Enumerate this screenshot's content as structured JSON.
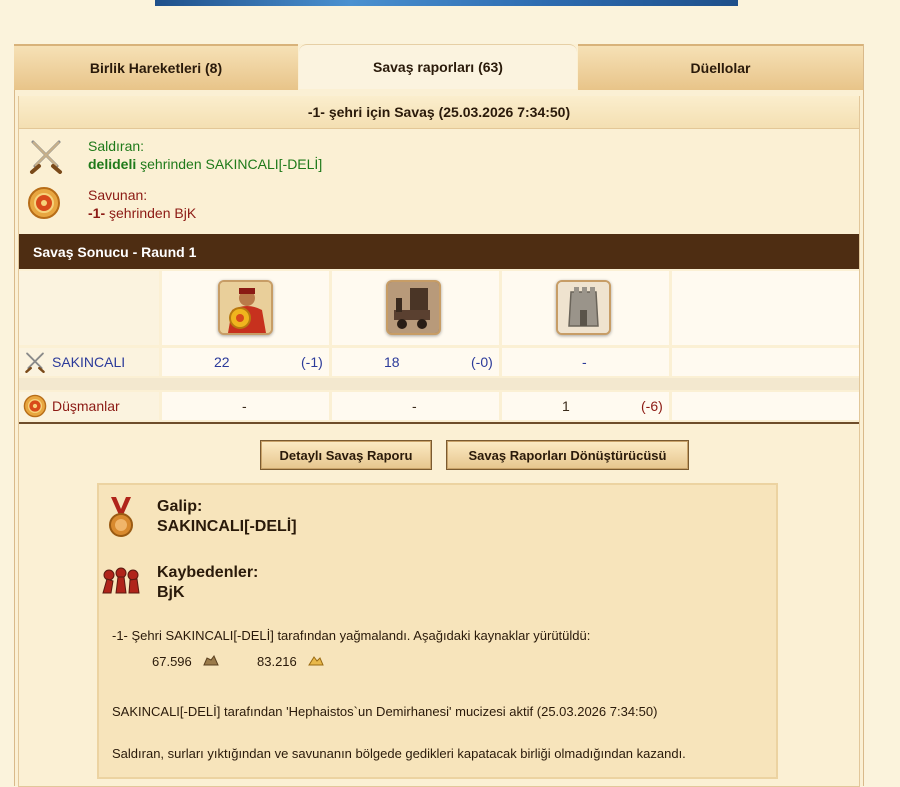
{
  "tabs": [
    {
      "label": "Birlik Hareketleri (8)"
    },
    {
      "label": "Savaş raporları (63)"
    },
    {
      "label": "Düellolar"
    }
  ],
  "report": {
    "title": "-1- şehri için Savaş (25.03.2026 7:34:50)",
    "attacker": {
      "role_label": "Saldıran:",
      "city": "delideli",
      "text": " şehrinden SAKINCALI[-DELİ]"
    },
    "defender": {
      "role_label": "Savunan:",
      "city": "-1-",
      "text": " şehrinden BjK"
    },
    "result_title": "Savaş Sonucu - Raund 1",
    "rows": [
      {
        "name": "SAKINCALI",
        "cells": [
          {
            "value": "22",
            "loss": "(-1)"
          },
          {
            "value": "18",
            "loss": "(-0)"
          },
          {
            "value": "-",
            "loss": ""
          }
        ]
      },
      {
        "name": "Düşmanlar",
        "cells": [
          {
            "value": "-",
            "loss": ""
          },
          {
            "value": "-",
            "loss": ""
          },
          {
            "value": "1",
            "loss": "(-6)"
          }
        ]
      }
    ]
  },
  "buttons": {
    "detail": "Detaylı Savaş Raporu",
    "converter": "Savaş Raporları Dönüştürücüsü"
  },
  "summary": {
    "winner_label": "Galip:",
    "winner_name": "SAKINCALI[-DELİ]",
    "losers_label": "Kaybedenler:",
    "losers_name": "BjK",
    "plunder_text": "-1- Şehri SAKINCALI[-DELİ] tarafından yağmalandı. Aşağıdaki kaynaklar yürütüldü:",
    "resource1": "67.596",
    "resource2": "83.216",
    "wonder_text": "SAKINCALI[-DELİ] tarafından 'Hephaistos`un Demirhanesi' mucizesi aktif (25.03.2026 7:34:50)",
    "win_reason": "Saldıran, surları yıktığından ve savunanın bölgede gedikleri kapatacak birliği olmadığından kazandı."
  },
  "colors": {
    "accent_bar": "#4e2d12",
    "attacker_green": "#1f7a1a",
    "defender_red": "#8c1a14",
    "troop_blue": "#2b3a9a"
  },
  "icons": [
    "crossed-swords-icon",
    "shield-icon",
    "warrior-unit-icon",
    "catapult-unit-icon",
    "wall-icon",
    "medal-icon",
    "fallen-soldiers-icon",
    "stone-resource-icon",
    "gold-resource-icon"
  ]
}
